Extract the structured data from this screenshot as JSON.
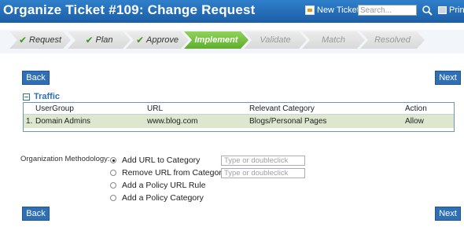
{
  "header": {
    "title": "Organize Ticket #109: Change Request",
    "new_ticket_label": "New Ticket",
    "search_placeholder": "Search...",
    "print_label": "Print"
  },
  "steps": [
    {
      "label": "Request",
      "state": "done"
    },
    {
      "label": "Plan",
      "state": "done"
    },
    {
      "label": "Approve",
      "state": "done"
    },
    {
      "label": "Implement",
      "state": "current"
    },
    {
      "label": "Validate",
      "state": "pending"
    },
    {
      "label": "Match",
      "state": "pending"
    },
    {
      "label": "Resolved",
      "state": "pending"
    }
  ],
  "nav": {
    "back_label": "Back",
    "next_label": "Next"
  },
  "traffic": {
    "title": "Traffic",
    "columns": [
      "UserGroup",
      "URL",
      "Relevant Category",
      "Action"
    ],
    "rows": [
      {
        "index": "1.",
        "usergroup": "Domain Admins",
        "url": "www.blog.com",
        "category": "Blogs/Personal Pages",
        "action": "Allow"
      }
    ]
  },
  "methodology": {
    "label": "Organization Methodology:",
    "options": [
      {
        "label": "Add URL to Category",
        "selected": true,
        "placeholder": "Type or doubleclick"
      },
      {
        "label": "Remove URL from Category",
        "selected": false,
        "placeholder": "Type or doubleclick"
      },
      {
        "label": "Add a Policy URL Rule",
        "selected": false
      },
      {
        "label": "Add a Policy Category",
        "selected": false
      }
    ]
  },
  "colors": {
    "header_blue": "#1c5ea6",
    "button_blue": "#2f6fb4",
    "current_step_green": "#5fae2c",
    "row_green": "#dde6cf"
  },
  "icons": {
    "check": "check-icon",
    "new_ticket": "new-ticket-icon",
    "search": "search-icon",
    "print": "printer-icon",
    "collapse": "minus-box-icon"
  }
}
